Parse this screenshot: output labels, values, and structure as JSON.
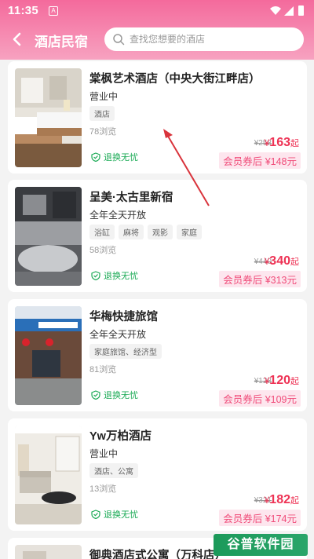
{
  "status_bar": {
    "time": "11:35",
    "app_icon_glyph": "A"
  },
  "navbar": {
    "title": "酒店民宿",
    "search_placeholder": "查找您想要的酒店"
  },
  "hotels": [
    {
      "name": "棠枫艺术酒店（中央大街江畔店）",
      "status": "营业中",
      "tags": [
        "酒店"
      ],
      "views": "78浏览",
      "guarantee": "退换无忧",
      "original_price": "¥258",
      "currency": "¥",
      "price": "163",
      "price_unit": "起",
      "member_price": "会员券后 ¥148元",
      "image": "hotel-room-beds"
    },
    {
      "name": "呈美·太古里新宿",
      "status": "全年全天开放",
      "tags": [
        "浴缸",
        "麻将",
        "观影",
        "家庭"
      ],
      "views": "58浏览",
      "guarantee": "退换无忧",
      "original_price": "¥440",
      "currency": "¥",
      "price": "340",
      "price_unit": "起",
      "member_price": "会员券后 ¥313元",
      "image": "hotel-room-gray"
    },
    {
      "name": "华梅快捷旅馆",
      "status": "全年全天开放",
      "tags": [
        "家庭旅馆、经济型"
      ],
      "views": "81浏览",
      "guarantee": "退换无忧",
      "original_price": "¥128",
      "currency": "¥",
      "price": "120",
      "price_unit": "起",
      "member_price": "会员券后 ¥109元",
      "image": "hotel-storefront"
    },
    {
      "name": "Yw万柏酒店",
      "status": "营业中",
      "tags": [
        "酒店、公寓"
      ],
      "views": "13浏览",
      "guarantee": "退换无忧",
      "original_price": "¥321",
      "currency": "¥",
      "price": "182",
      "price_unit": "起",
      "member_price": "会员券后 ¥174元",
      "image": "hotel-living-room"
    },
    {
      "name": "御典酒店式公寓（万科店）",
      "image": "hotel-room-partial"
    }
  ],
  "watermark": "谷普软件园",
  "colors": {
    "header_pink": "#f46a9c",
    "price_red": "#ee3355",
    "guarantee_green": "#1aaa55",
    "annotation_arrow": "#d9343c"
  }
}
